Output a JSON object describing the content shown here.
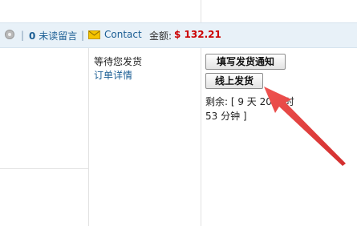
{
  "toolbar": {
    "sep1": "|",
    "unread_count": "0",
    "unread_label": "未读留言",
    "sep2": "|",
    "contact_label": "Contact",
    "amount_label": "金额:",
    "amount_value": "$ 132.21",
    "icons": [
      "settings-icon",
      "mail-icon"
    ]
  },
  "order": {
    "status": "等待您发货",
    "details_link": "订单详情"
  },
  "actions": {
    "notify_button": "填写发货通知",
    "online_button": "线上发货",
    "remaining_line1": "剩余: [ 9 天 20 小时",
    "remaining_line2": "53 分钟 ]"
  },
  "annotation": {
    "arrow_color": "#e53935"
  }
}
